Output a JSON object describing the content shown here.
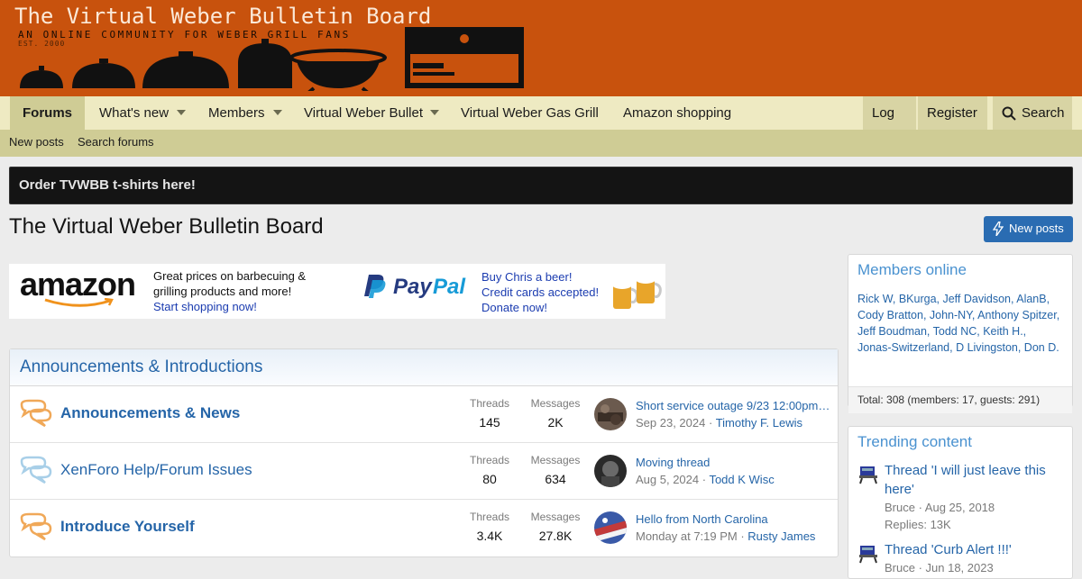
{
  "banner": {
    "title": "The Virtual Weber Bulletin Board",
    "tagline": "AN ONLINE COMMUNITY FOR WEBER GRILL FANS",
    "est": "EST. 2000"
  },
  "nav": {
    "forums": "Forums",
    "whats_new": "What's new",
    "members": "Members",
    "virtual_weber_bullet": "Virtual Weber Bullet",
    "gas_grill": "Virtual Weber Gas Grill",
    "amazon": "Amazon shopping",
    "login": "Log in",
    "register": "Register",
    "search": "Search"
  },
  "subnav": {
    "new_posts": "New posts",
    "search_forums": "Search forums"
  },
  "notice": "Order TVWBB t-shirts here!",
  "page_title": "The Virtual Weber Bulletin Board",
  "new_posts_button": "New posts",
  "ads": {
    "amazon_logo": "amazon",
    "amazon_line1": "Great prices on barbecuing &",
    "amazon_line2": "grilling products and more!",
    "amazon_link": "Start shopping now!",
    "paypal_logo": "PayPal",
    "paypal_line1": "Buy Chris a beer!",
    "paypal_line2": "Credit cards accepted!",
    "paypal_line3": "Donate now!"
  },
  "category": {
    "title": "Announcements & Introductions",
    "nodes": [
      {
        "title": "Announcements & News",
        "threads_label": "Threads",
        "threads": "145",
        "messages_label": "Messages",
        "messages": "2K",
        "last_title": "Short service outage 9/23 12:00pm ...",
        "last_date": "Sep 23, 2024",
        "last_user": "Timothy F. Lewis"
      },
      {
        "title": "XenForo Help/Forum Issues",
        "threads_label": "Threads",
        "threads": "80",
        "messages_label": "Messages",
        "messages": "634",
        "last_title": "Moving thread",
        "last_date": "Aug 5, 2024",
        "last_user": "Todd K Wisc"
      },
      {
        "title": "Introduce Yourself",
        "threads_label": "Threads",
        "threads": "3.4K",
        "messages_label": "Messages",
        "messages": "27.8K",
        "last_title": "Hello from North Carolina",
        "last_date": "Monday at 7:19 PM",
        "last_user": "Rusty James"
      }
    ]
  },
  "members_online": {
    "title": "Members online",
    "list": "Rick W, BKurga, Jeff Davidson, AlanB, Cody Bratton, John-NY, Anthony Spitzer, Jeff Boudman, Todd NC, Keith H., Jonas-Switzerland, D Livingston, Don D.",
    "total": "Total: 308 (members: 17, guests: 291)"
  },
  "trending": {
    "title": "Trending content",
    "items": [
      {
        "title": "Thread 'I will just leave this here'",
        "meta": "Bruce · Aug 25, 2018",
        "replies": "Replies: 13K"
      },
      {
        "title": "Thread 'Curb Alert !!!'",
        "meta": "Bruce · Jun 18, 2023"
      }
    ]
  },
  "colors": {
    "banner": "#c8520d",
    "nav": "#eeeac2",
    "subnav": "#cfcc95",
    "link": "#2565a8",
    "button": "#2a6cb2"
  }
}
